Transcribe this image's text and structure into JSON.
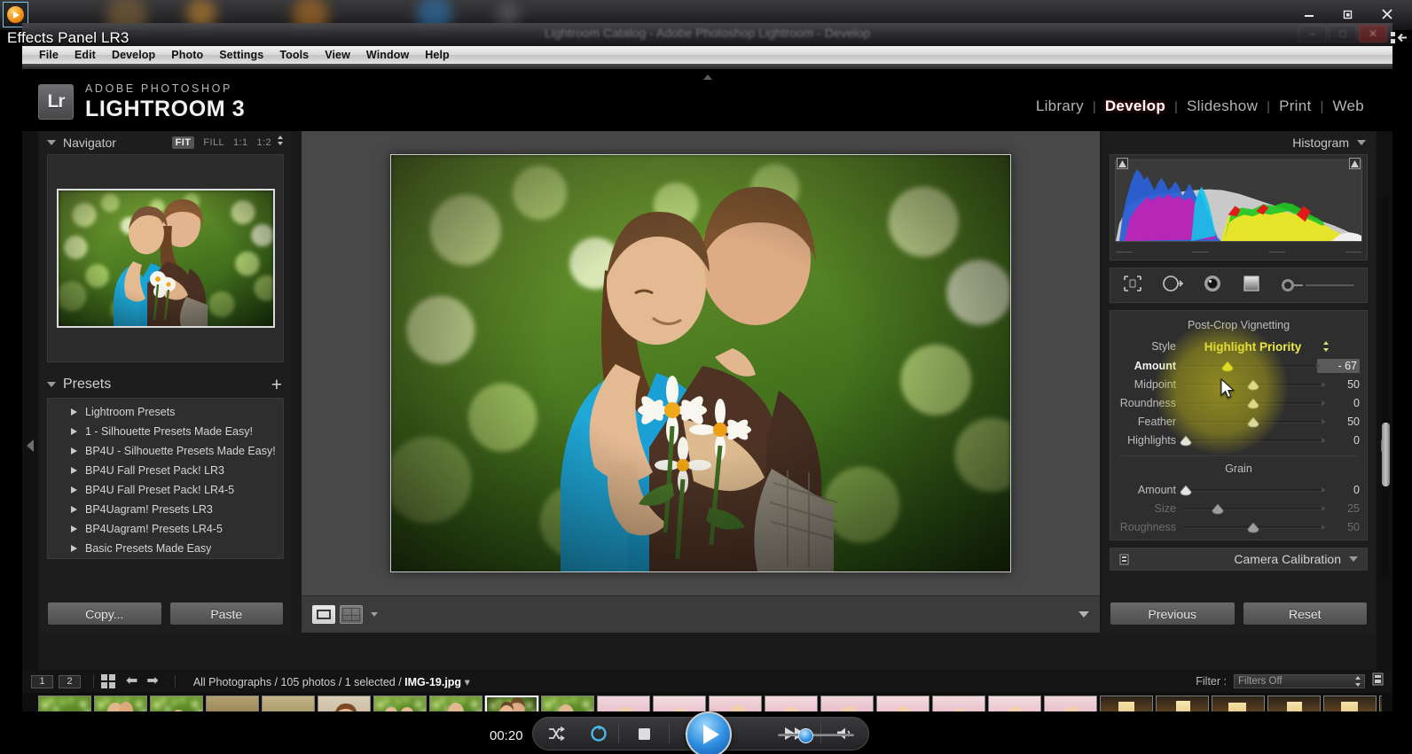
{
  "overlay": {
    "caption": "Effects Panel LR3",
    "player_icon": "media-player-icon"
  },
  "window": {
    "title": "Lightroom Catalog - Adobe Photoshop Lightroom - Develop",
    "controls": {
      "minimize": "minimize-icon",
      "restore": "restore-icon",
      "close": "close-icon"
    }
  },
  "menubar": {
    "items": [
      "File",
      "Edit",
      "Develop",
      "Photo",
      "Settings",
      "Tools",
      "View",
      "Window",
      "Help"
    ]
  },
  "identity": {
    "badge": "Lr",
    "line1": "ADOBE PHOTOSHOP",
    "line2": "LIGHTROOM 3"
  },
  "modules": {
    "items": [
      {
        "label": "Library",
        "active": false
      },
      {
        "label": "Develop",
        "active": true
      },
      {
        "label": "Slideshow",
        "active": false
      },
      {
        "label": "Print",
        "active": false
      },
      {
        "label": "Web",
        "active": false
      }
    ],
    "separator": "|"
  },
  "navigator": {
    "title": "Navigator",
    "zoom_options": [
      {
        "label": "FIT",
        "selected": true
      },
      {
        "label": "FILL",
        "selected": false
      },
      {
        "label": "1:1",
        "selected": false
      },
      {
        "label": "1:2",
        "selected": false
      }
    ]
  },
  "presets": {
    "title": "Presets",
    "add_label": "+",
    "items": [
      "Lightroom Presets",
      "1 - Silhouette Presets Made Easy!",
      "BP4U - Silhouette Presets Made Easy!",
      "BP4U Fall Preset Pack! LR3",
      "BP4U Fall Preset Pack! LR4-5",
      "BP4Uagram! Presets LR3",
      "BP4Uagram! Presets LR4-5",
      "Basic Presets Made Easy"
    ]
  },
  "left_buttons": {
    "copy": "Copy...",
    "paste": "Paste"
  },
  "histogram": {
    "title": "Histogram"
  },
  "tool_strip": {
    "tools": [
      "crop-overlay-icon",
      "spot-removal-icon",
      "red-eye-icon",
      "graduated-filter-icon",
      "adjustment-brush-icon"
    ]
  },
  "effects": {
    "section_title": "Post-Crop Vignetting",
    "style_label": "Style",
    "style_value": "Highlight Priority",
    "sliders": [
      {
        "label": "Amount",
        "value": "- 67",
        "pos": 33,
        "highlight": true,
        "boxed": true,
        "dim": false
      },
      {
        "label": "Midpoint",
        "value": "50",
        "pos": 50,
        "highlight": false,
        "boxed": false,
        "dim": false
      },
      {
        "label": "Roundness",
        "value": "0",
        "pos": 50,
        "highlight": false,
        "boxed": false,
        "dim": false
      },
      {
        "label": "Feather",
        "value": "50",
        "pos": 50,
        "highlight": false,
        "boxed": false,
        "dim": false
      },
      {
        "label": "Highlights",
        "value": "0",
        "pos": 2,
        "highlight": false,
        "boxed": false,
        "dim": false
      }
    ],
    "grain_title": "Grain",
    "grain_sliders": [
      {
        "label": "Amount",
        "value": "0",
        "pos": 2,
        "dim": false
      },
      {
        "label": "Size",
        "value": "25",
        "pos": 25,
        "dim": true
      },
      {
        "label": "Roughness",
        "value": "50",
        "pos": 50,
        "dim": true
      }
    ]
  },
  "camera_calibration": {
    "title": "Camera Calibration"
  },
  "right_buttons": {
    "previous": "Previous",
    "reset": "Reset"
  },
  "filmstrip": {
    "page_1": "1",
    "page_2": "2",
    "grid_icon": "grid-view-icon",
    "back_icon": "navigate-back-icon",
    "forward_icon": "navigate-forward-icon",
    "path_prefix": "All Photographs / 105 photos / 1 selected / ",
    "filename": "IMG-19.jpg",
    "filter_label": "Filter :",
    "filter_value": "Filters Off"
  },
  "player": {
    "time": "00:20",
    "buttons": [
      "shuffle-icon",
      "repeat-icon",
      "stop-icon",
      "rewind-icon",
      "play-icon",
      "fast-forward-icon",
      "mute-icon"
    ],
    "volume_percent": 28
  },
  "colors": {
    "accent_yellow": "#ecec4a",
    "panel_bg": "#2e2e2e",
    "app_bg": "#1d1d1d",
    "center_bg": "#484848",
    "text": "#d5d5d5",
    "play_blue": "#2f8fe0",
    "progress_blue": "#1b6fd8"
  }
}
